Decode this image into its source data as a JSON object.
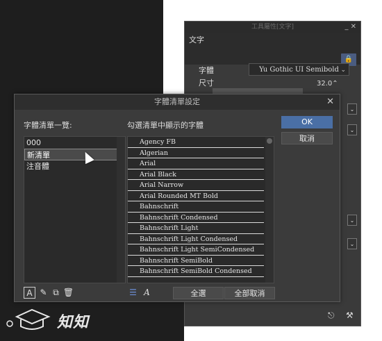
{
  "tool_panel": {
    "title": "工具屬性[文字]",
    "window_controls": "_ ✕",
    "header_label": "文字",
    "lock_icon": "lock-icon",
    "font_label": "字體",
    "font_value": "Yu Gothic UI Semibold",
    "size_label": "尺寸",
    "size_value": "32.0"
  },
  "dialog": {
    "title": "字體清單設定",
    "left_heading": "字體清單一覽:",
    "right_heading": "勾選清單中顯示的字體",
    "lists": [
      {
        "label": "000",
        "selected": false
      },
      {
        "label": "新清單",
        "selected": true
      },
      {
        "label": "注音體",
        "selected": false
      }
    ],
    "fonts": [
      "Agency FB",
      "Algerian",
      "Arial",
      "Arial Black",
      "Arial Narrow",
      "Arial Rounded MT Bold",
      "Bahnschrift",
      "Bahnschrift Condensed",
      "Bahnschrift Light",
      "Bahnschrift Light Condensed",
      "Bahnschrift Light SemiCondensed",
      "Bahnschrift SemiBold",
      "Bahnschrift SemiBold Condensed"
    ],
    "ok_label": "OK",
    "cancel_label": "取消",
    "select_all_label": "全選",
    "deselect_all_label": "全部取消"
  },
  "watermark": {
    "text": "知知"
  },
  "colors": {
    "accent": "#4a6fa5",
    "dialog_bg": "#3b3b3b",
    "list_bg": "#2a2a2a"
  }
}
